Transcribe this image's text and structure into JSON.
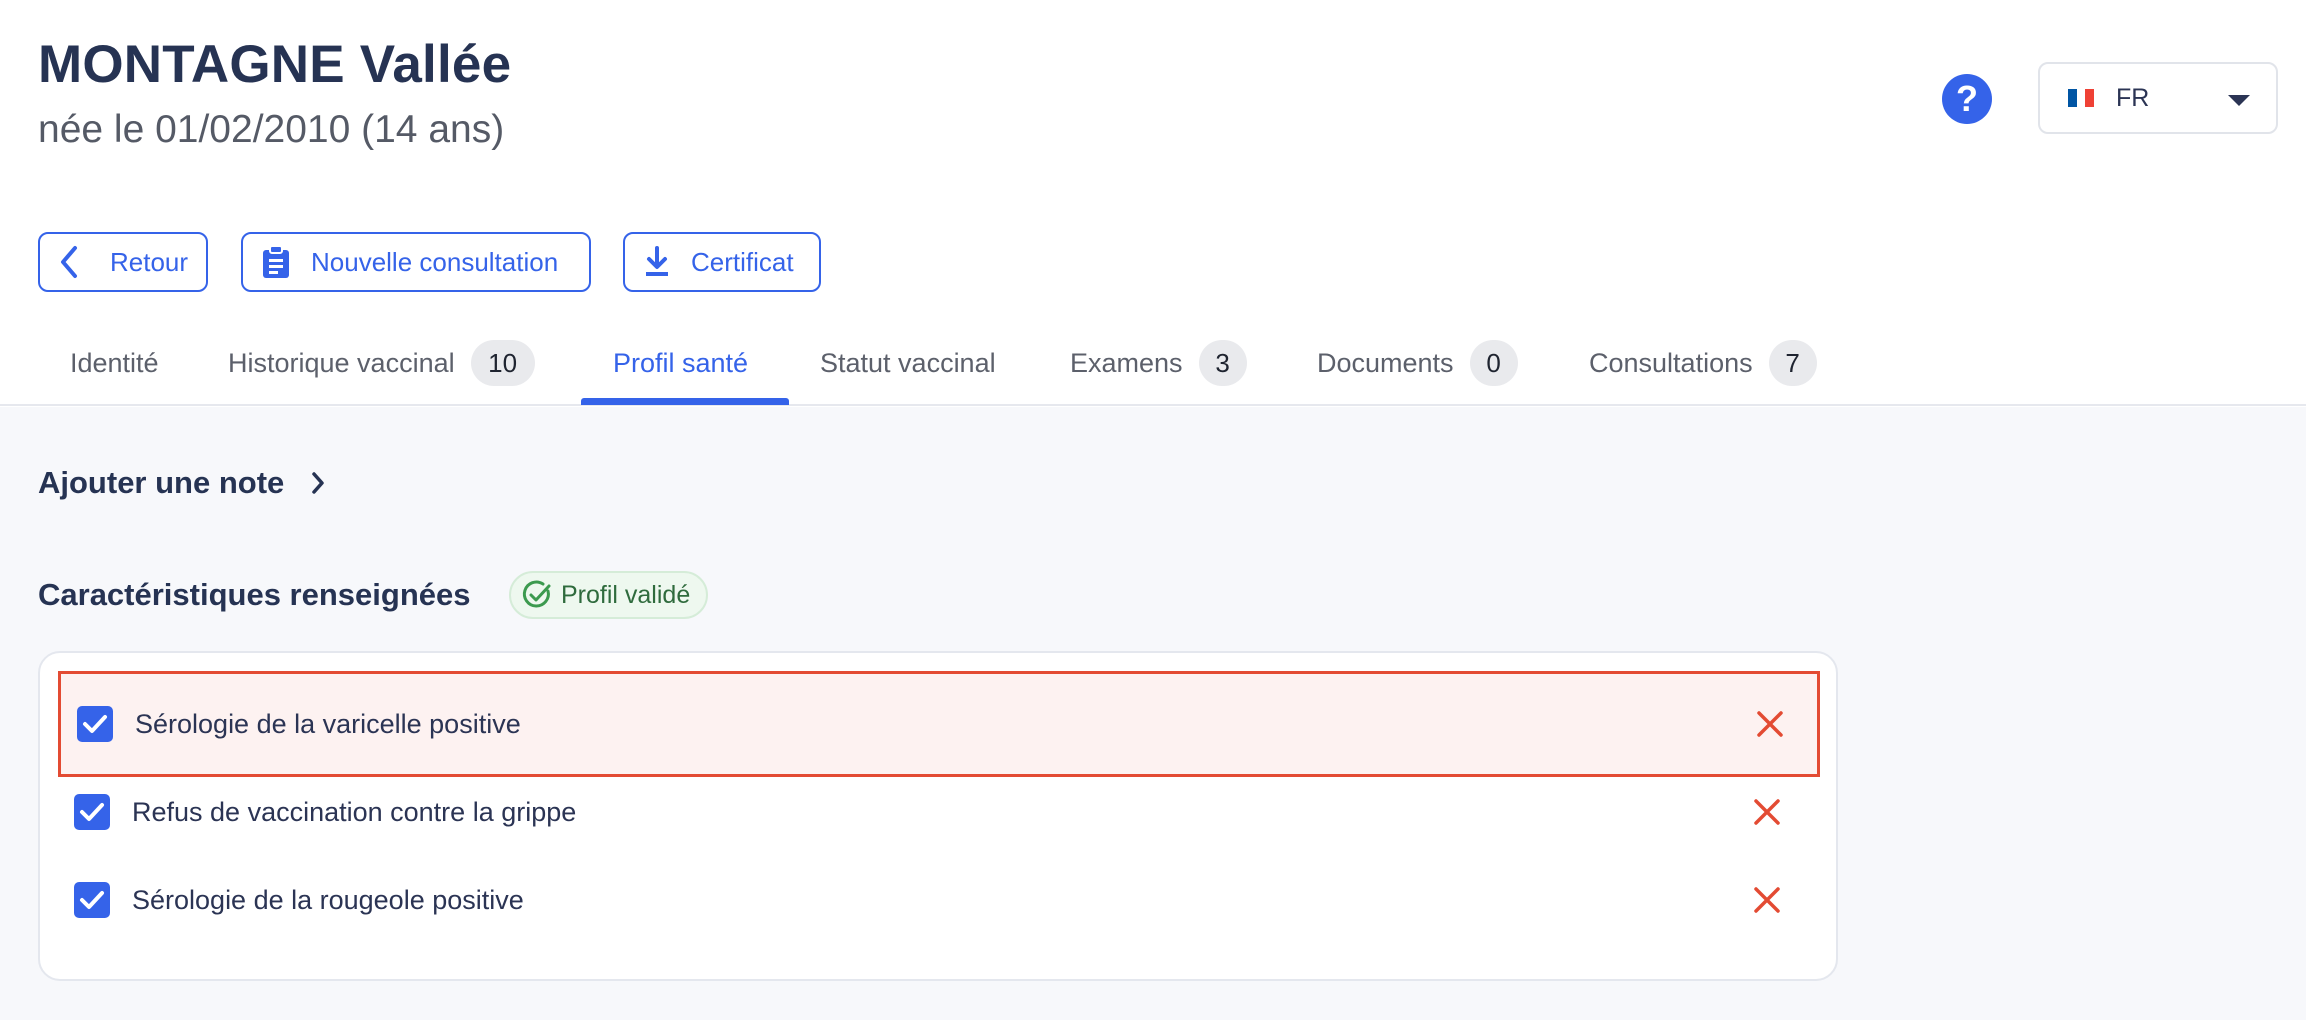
{
  "patient": {
    "name": "MONTAGNE Vallée",
    "dob_line": "née le 01/02/2010 (14 ans)"
  },
  "header": {
    "help_label": "?",
    "language": {
      "selected": "FR",
      "flag_colors": [
        "#0055a4",
        "#ffffff",
        "#ef4135"
      ]
    }
  },
  "actions": {
    "back_label": "Retour",
    "new_consultation_label": "Nouvelle consultation",
    "certificate_label": "Certificat"
  },
  "tabs": [
    {
      "label": "Identité"
    },
    {
      "label": "Historique vaccinal",
      "count": "10"
    },
    {
      "label": "Profil santé",
      "active": true
    },
    {
      "label": "Statut vaccinal"
    },
    {
      "label": "Examens",
      "count": "3"
    },
    {
      "label": "Documents",
      "count": "0"
    },
    {
      "label": "Consultations",
      "count": "7"
    }
  ],
  "notes": {
    "add_label": "Ajouter une note"
  },
  "characteristics": {
    "title": "Caractéristiques renseignées",
    "status_badge": "Profil validé",
    "items": [
      {
        "label": "Sérologie de la varicelle positive",
        "checked": true,
        "highlighted": true
      },
      {
        "label": "Refus de vaccination contre la grippe",
        "checked": true
      },
      {
        "label": "Sérologie de la rougeole positive",
        "checked": true
      }
    ]
  },
  "colors": {
    "accent": "#3563e9",
    "danger": "#e34b33",
    "success": "#3c9a4f"
  },
  "icons": [
    "chevron-left-icon",
    "clipboard-icon",
    "download-icon",
    "chevron-right-icon",
    "check-circle-icon",
    "checkbox-check-icon",
    "close-icon",
    "help-icon",
    "caret-down-icon"
  ]
}
